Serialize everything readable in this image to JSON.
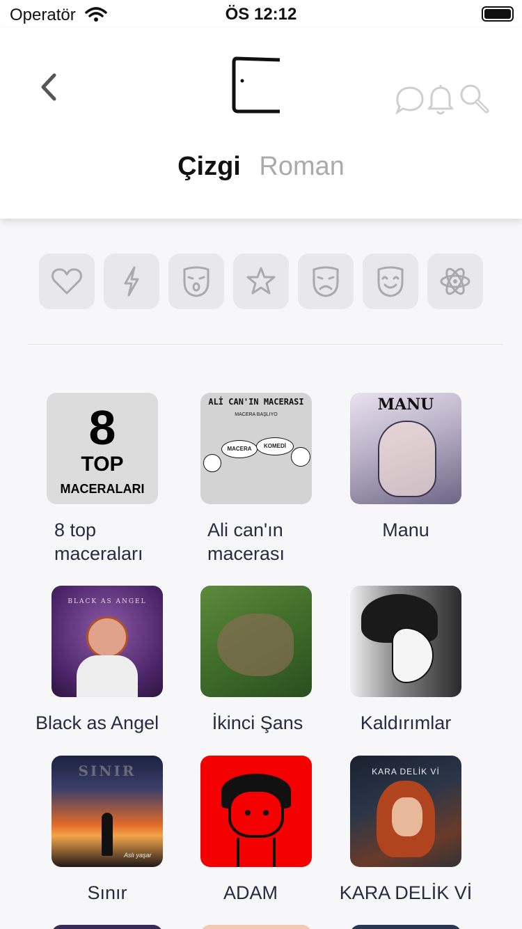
{
  "status_bar": {
    "carrier": "Operatör",
    "time": "ÖS 12:12"
  },
  "header": {
    "icons": [
      "back-chevron-icon",
      "logo-icon",
      "chat-bubble-icon",
      "bell-icon",
      "search-icon"
    ],
    "tabs": [
      {
        "label": "Çizgi",
        "active": true
      },
      {
        "label": "Roman",
        "active": false
      }
    ]
  },
  "genres": [
    "heart-icon",
    "lightning-icon",
    "shocked-mask-icon",
    "star-icon",
    "sad-mask-icon",
    "happy-mask-icon",
    "atom-icon"
  ],
  "comics": [
    {
      "title": "8 top maceraları",
      "cover_text": [
        "8",
        "TOP",
        "MACERALARI"
      ]
    },
    {
      "title": "Ali can'ın macerası",
      "cover_text": [
        "ALİ CAN'IN MACERASI",
        "MACERA BAŞLIYO",
        "MACERA",
        "KOMEDİ"
      ]
    },
    {
      "title": "Manu",
      "cover_text": [
        "MANU"
      ]
    },
    {
      "title": "Black as Angel",
      "cover_text": [
        "BLACK AS ANGEL"
      ]
    },
    {
      "title": "İkinci Şans",
      "cover_text": []
    },
    {
      "title": "Kaldırımlar",
      "cover_text": []
    },
    {
      "title": "Sınır",
      "cover_text": [
        "SINIR",
        "Aslı yaşar"
      ]
    },
    {
      "title": "ADAM",
      "cover_text": []
    },
    {
      "title": "KARA DELİK Vİ",
      "cover_text": [
        "KARA DELİK Vİ"
      ]
    }
  ],
  "colors": {
    "accent_text": "#2a2a40",
    "tab_active": "#111111",
    "tab_inactive": "#aaaaaa",
    "adam_cover": "#f50000"
  }
}
